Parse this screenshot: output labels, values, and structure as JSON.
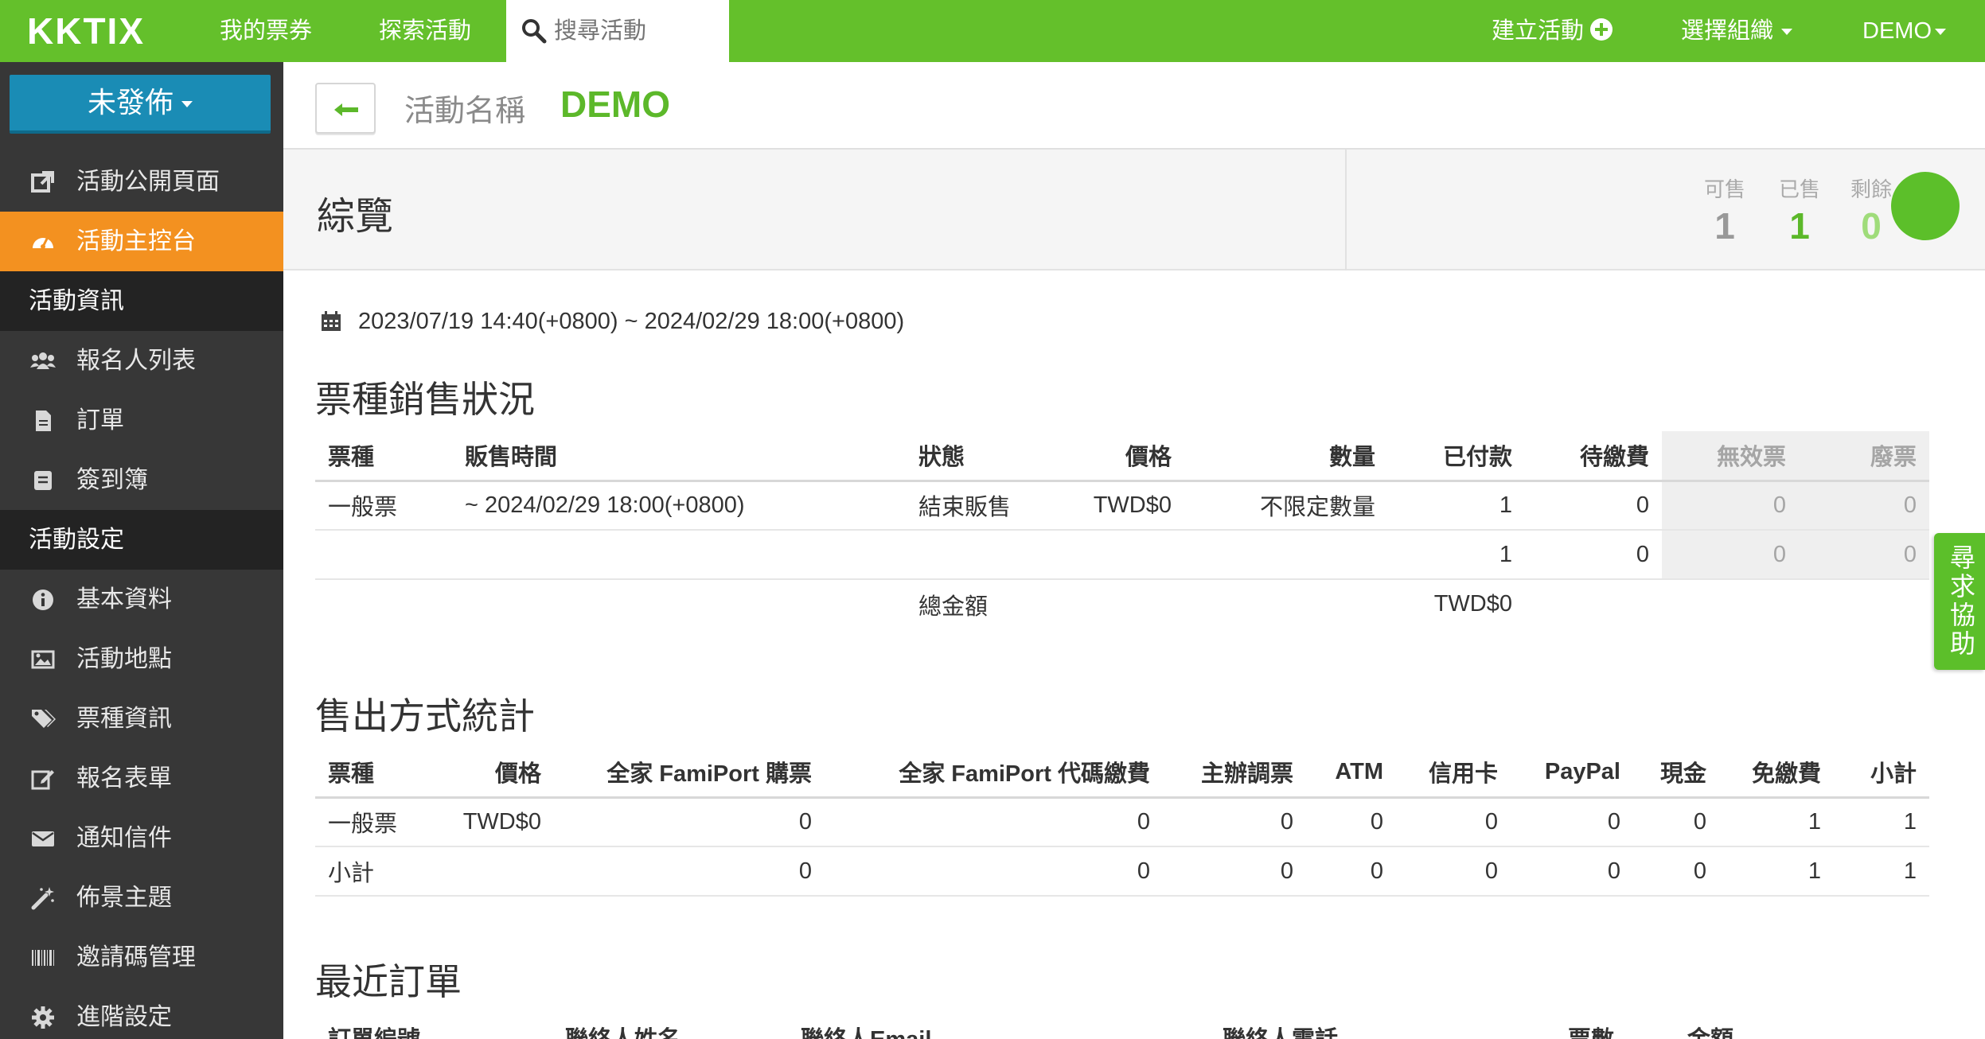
{
  "topbar": {
    "logo": "KKTIX",
    "nav_my_tickets": "我的票券",
    "nav_explore": "探索活動",
    "search_placeholder": "搜尋活動",
    "create_event": "建立活動",
    "select_org": "選擇組織",
    "user": "DEMO"
  },
  "sidebar": {
    "status_button": "未發佈",
    "items": [
      {
        "label": "活動公開頁面",
        "icon": "external-link-icon"
      },
      {
        "label": "活動主控台",
        "icon": "dashboard-icon"
      }
    ],
    "section_event_info": "活動資訊",
    "info_items": [
      {
        "label": "報名人列表",
        "icon": "users-icon"
      },
      {
        "label": "訂單",
        "icon": "document-icon"
      },
      {
        "label": "簽到簿",
        "icon": "list-book-icon"
      }
    ],
    "section_event_settings": "活動設定",
    "settings_items": [
      {
        "label": "基本資料",
        "icon": "info-icon"
      },
      {
        "label": "活動地點",
        "icon": "image-icon"
      },
      {
        "label": "票種資訊",
        "icon": "tags-icon"
      },
      {
        "label": "報名表單",
        "icon": "edit-icon"
      },
      {
        "label": "通知信件",
        "icon": "envelope-icon"
      },
      {
        "label": "佈景主題",
        "icon": "magic-wand-icon"
      },
      {
        "label": "邀請碼管理",
        "icon": "barcode-icon"
      },
      {
        "label": "進階設定",
        "icon": "gear-icon"
      }
    ]
  },
  "header": {
    "event_label": "活動名稱",
    "event_name": "DEMO"
  },
  "overview": {
    "title": "綜覽",
    "stats": {
      "available_label": "可售",
      "available_value": "1",
      "sold_label": "已售",
      "sold_value": "1",
      "remaining_label": "剩餘",
      "remaining_value": "0"
    },
    "progress_fraction": 1.0
  },
  "date_range": "2023/07/19 14:40(+0800) ~ 2024/02/29 18:00(+0800)",
  "ticket_sales": {
    "title": "票種銷售狀況",
    "columns": [
      "票種",
      "販售時間",
      "狀態",
      "價格",
      "數量",
      "已付款",
      "待繳費",
      "無效票",
      "廢票"
    ],
    "row": {
      "type": "一般票",
      "sale_time": "~ 2024/02/29 18:00(+0800)",
      "status": "結束販售",
      "price": "TWD$0",
      "quantity": "不限定數量",
      "paid": "1",
      "pending": "0",
      "invalid": "0",
      "void": "0"
    },
    "subtotal": {
      "paid": "1",
      "pending": "0",
      "invalid": "0",
      "void": "0"
    },
    "total_label": "總金額",
    "total_value": "TWD$0"
  },
  "payment_stats": {
    "title": "售出方式統計",
    "columns": [
      "票種",
      "價格",
      "全家 FamiPort 購票",
      "全家 FamiPort 代碼繳費",
      "主辦調票",
      "ATM",
      "信用卡",
      "PayPal",
      "現金",
      "免繳費",
      "小計"
    ],
    "row": {
      "type": "一般票",
      "price": "TWD$0",
      "famiport_buy": "0",
      "famiport_code": "0",
      "organizer": "0",
      "atm": "0",
      "credit": "0",
      "paypal": "0",
      "cash": "0",
      "free": "1",
      "subtotal": "1"
    },
    "subtotal_row": {
      "label": "小計",
      "famiport_buy": "0",
      "famiport_code": "0",
      "organizer": "0",
      "atm": "0",
      "credit": "0",
      "paypal": "0",
      "cash": "0",
      "free": "1",
      "subtotal": "1"
    }
  },
  "recent_orders": {
    "title": "最近訂單",
    "columns": [
      "訂單編號",
      "聯絡人姓名",
      "聯絡人Email",
      "聯絡人電話",
      "票數",
      "金額"
    ]
  },
  "help_tab": "尋求協助"
}
